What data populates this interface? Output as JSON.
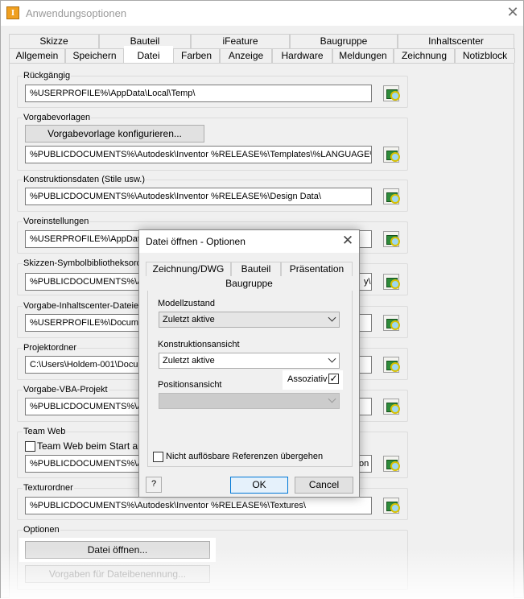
{
  "window": {
    "title": "Anwendungsoptionen",
    "icon_letter": "I"
  },
  "tabs_top": [
    "Skizze",
    "Bauteil",
    "iFeature",
    "Baugruppe",
    "Inhaltscenter"
  ],
  "tabs_bottom": [
    "Allgemein",
    "Speichern",
    "Datei",
    "Farben",
    "Anzeige",
    "Hardware",
    "Meldungen",
    "Zeichnung",
    "Notizblock"
  ],
  "groups": {
    "undo": {
      "label": "Rückgängig",
      "path": "%USERPROFILE%\\AppData\\Local\\Temp\\"
    },
    "templates": {
      "label": "Vorgabevorlagen",
      "button": "Vorgabevorlage konfigurieren...",
      "path": "%PUBLICDOCUMENTS%\\Autodesk\\Inventor %RELEASE%\\Templates\\%LANGUAGE%\\"
    },
    "design_data": {
      "label": "Konstruktionsdaten (Stile usw.)",
      "path": "%PUBLICDOCUMENTS%\\Autodesk\\Inventor %RELEASE%\\Design Data\\"
    },
    "presets": {
      "label": "Voreinstellungen",
      "path": "%USERPROFILE%\\AppData"
    },
    "sketch_symbols": {
      "label": "Skizzen-Symbolbibliotheksordn",
      "path": "%PUBLICDOCUMENTS%\\Au",
      "path_tail": "y\\"
    },
    "content_center": {
      "label": "Vorgabe-Inhaltscenter-Dateie",
      "path": "%USERPROFILE%\\Documen"
    },
    "projects": {
      "label": "Projektordner",
      "path": "C:\\Users\\Holdem-001\\Docum"
    },
    "vba": {
      "label": "Vorgabe-VBA-Projekt",
      "path": "%PUBLICDOCUMENTS%\\Au"
    },
    "team_web": {
      "label": "Team Web",
      "checkbox": "Team Web beim Start anze",
      "path": "%PUBLICDOCUMENTS%\\Au",
      "path_tail": "ton"
    },
    "textures": {
      "label": "Texturordner",
      "path": "%PUBLICDOCUMENTS%\\Autodesk\\Inventor %RELEASE%\\Textures\\"
    },
    "options": {
      "label": "Optionen",
      "open_button": "Datei öffnen...",
      "naming_button": "Vorgaben für Dateibenennung..."
    }
  },
  "dialog": {
    "title": "Datei öffnen - Optionen",
    "tabs": [
      "Zeichnung/DWG",
      "Bauteil",
      "Präsentation",
      "Baugruppe"
    ],
    "model_state": {
      "label": "Modellzustand",
      "value": "Zuletzt aktive"
    },
    "design_view": {
      "label": "Konstruktionsansicht",
      "value": "Zuletzt aktive"
    },
    "associative": {
      "label": "Assoziativ",
      "checked": true
    },
    "position_view": {
      "label": "Positionsansicht",
      "value": ""
    },
    "unresolved": {
      "label": "Nicht auflösbare Referenzen übergehen",
      "checked": false
    },
    "ok": "OK",
    "cancel": "Cancel"
  }
}
